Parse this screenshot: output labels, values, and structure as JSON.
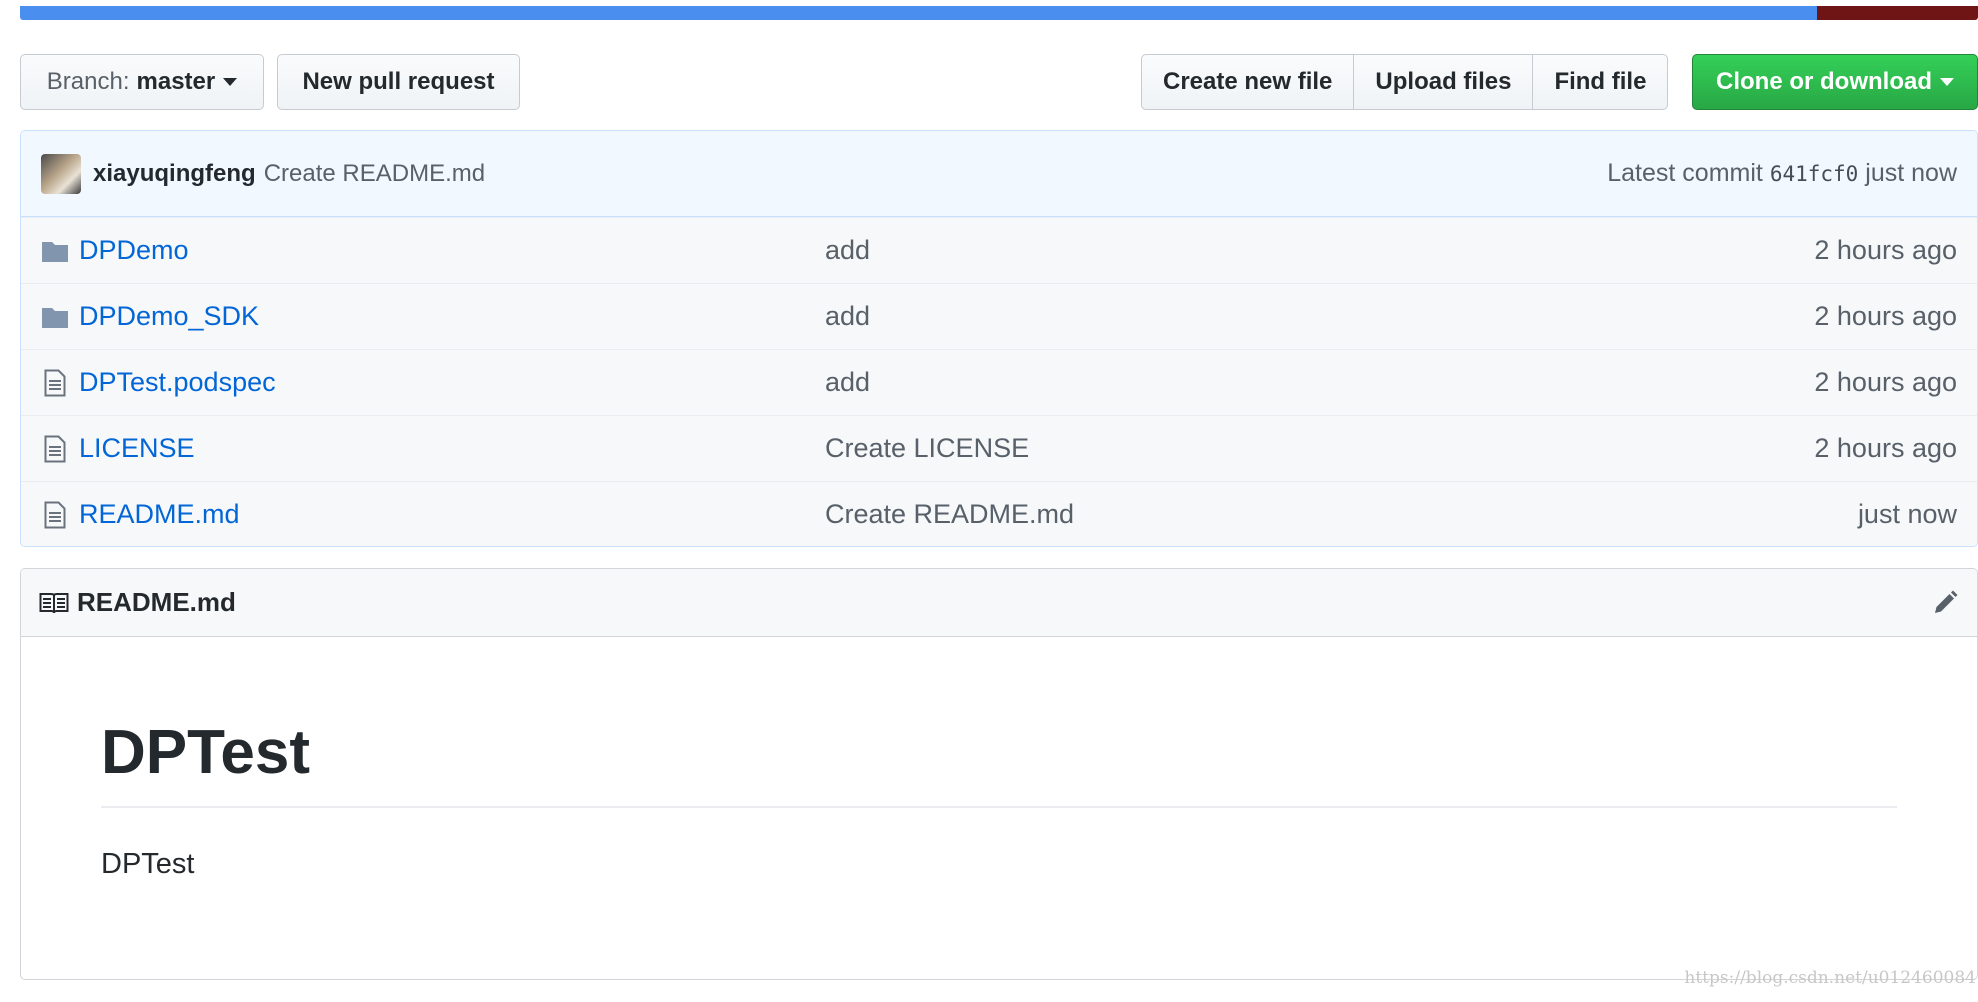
{
  "language_bar": [
    {
      "name": "blue",
      "color": "#4a8ef0",
      "fraction": 0.918
    },
    {
      "name": "dark-red",
      "color": "#701516",
      "fraction": 0.082
    }
  ],
  "toolbar": {
    "branch_prefix": "Branch:",
    "branch_name": "master",
    "new_pull_request": "New pull request",
    "create_new_file": "Create new file",
    "upload_files": "Upload files",
    "find_file": "Find file",
    "clone_or_download": "Clone or download"
  },
  "commit": {
    "author": "xiayuqingfeng",
    "message": "Create README.md",
    "latest_label": "Latest commit",
    "sha": "641fcf0",
    "time": "just now"
  },
  "files": [
    {
      "icon": "folder-icon",
      "name": "DPDemo",
      "message": "add",
      "age": "2 hours ago"
    },
    {
      "icon": "folder-icon",
      "name": "DPDemo_SDK",
      "message": "add",
      "age": "2 hours ago"
    },
    {
      "icon": "file-icon",
      "name": "DPTest.podspec",
      "message": "add",
      "age": "2 hours ago"
    },
    {
      "icon": "file-icon",
      "name": "LICENSE",
      "message": "Create LICENSE",
      "age": "2 hours ago"
    },
    {
      "icon": "file-icon",
      "name": "README.md",
      "message": "Create README.md",
      "age": "just now"
    }
  ],
  "readme": {
    "title": "README.md",
    "heading": "DPTest",
    "paragraph": "DPTest"
  },
  "watermark": "https://blog.csdn.net/u012460084",
  "colors": {
    "link": "#0366d6",
    "green_button": "#28a745",
    "commit_bg": "#f1f8ff"
  }
}
